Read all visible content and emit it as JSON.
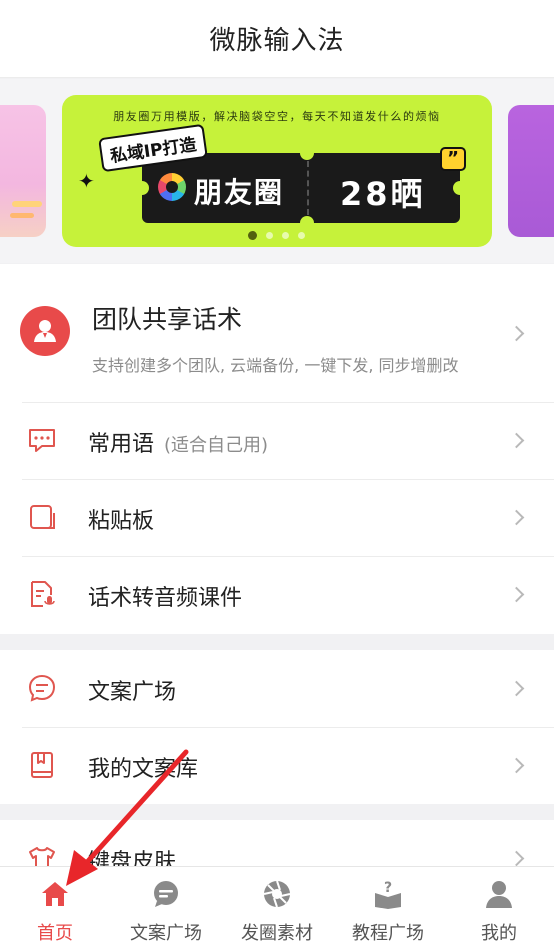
{
  "header": {
    "title": "微脉输入法"
  },
  "banner": {
    "tagline": "朋友圈万用模版，解决脑袋空空，每天不知道发什么的烦恼",
    "sticker": "私域IP打造",
    "ticket_text": "朋友圈",
    "ticket_number": "28晒",
    "quote_glyph": "”",
    "sparkle_glyph": "✦",
    "page_count": 4,
    "active_page": 1,
    "colors": {
      "background": "#c6f23a",
      "ticket": "#1a1a1a"
    }
  },
  "team": {
    "title": "团队共享话术",
    "subtitle": "支持创建多个团队, 云端备份, 一键下发, 同步增删改"
  },
  "menu_group1": [
    {
      "label": "常用语",
      "hint": "(适合自己用)",
      "icon": "chat-bubble-icon"
    },
    {
      "label": "粘贴板",
      "icon": "clipboard-icon"
    },
    {
      "label": "话术转音频课件",
      "icon": "audio-file-icon"
    }
  ],
  "menu_group2": [
    {
      "label": "文案广场",
      "icon": "copywriting-icon"
    },
    {
      "label": "我的文案库",
      "icon": "book-icon"
    }
  ],
  "menu_group3": [
    {
      "label": "键盘皮肤",
      "icon": "tshirt-icon"
    }
  ],
  "tabbar": {
    "items": [
      {
        "label": "首页",
        "icon": "home-icon",
        "active": true
      },
      {
        "label": "文案广场",
        "icon": "copywriting-tab-icon",
        "active": false
      },
      {
        "label": "发圈素材",
        "icon": "aperture-icon",
        "active": false
      },
      {
        "label": "教程广场",
        "icon": "tutorial-book-icon",
        "active": false
      },
      {
        "label": "我的",
        "icon": "profile-icon",
        "active": false
      }
    ]
  },
  "colors": {
    "accent": "#e84a4a",
    "icon_red": "#e0564f",
    "tab_gray": "#8a8a8a"
  }
}
